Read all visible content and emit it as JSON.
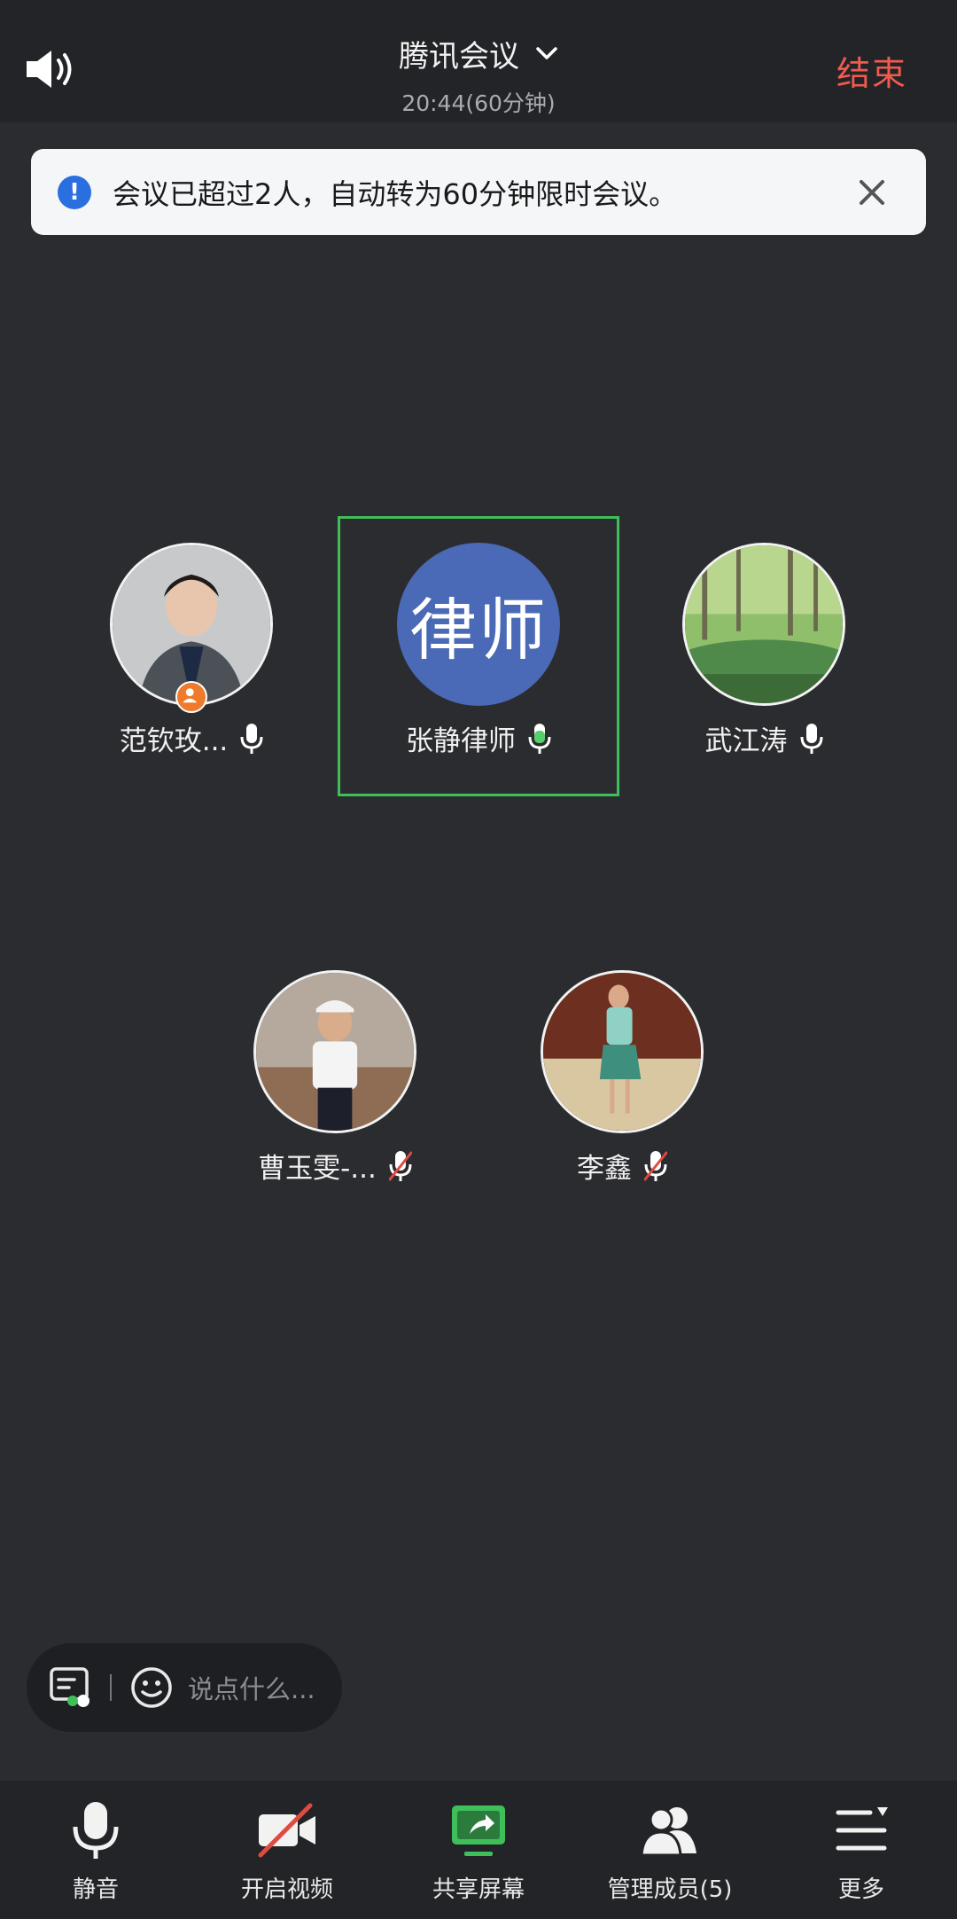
{
  "header": {
    "title": "腾讯会议",
    "subtitle": "20:44(60分钟)",
    "end_label": "结束"
  },
  "notice": {
    "message": "会议已超过2人，自动转为60分钟限时会议。"
  },
  "participants": [
    {
      "name": "范钦玫...",
      "mic": "on",
      "host": true
    },
    {
      "name": "张静律师",
      "avatar_text": "律师",
      "mic": "speaking",
      "active": true
    },
    {
      "name": "武江涛",
      "mic": "on"
    },
    {
      "name": "曹玉雯-...",
      "mic": "muted"
    },
    {
      "name": "李鑫",
      "mic": "muted"
    }
  ],
  "chat": {
    "placeholder": "说点什么..."
  },
  "toolbar": {
    "items": [
      {
        "label": "静音",
        "icon": "microphone-icon"
      },
      {
        "label": "开启视频",
        "icon": "camera-off-icon"
      },
      {
        "label": "共享屏幕",
        "icon": "share-screen-icon"
      },
      {
        "label": "管理成员(5)",
        "icon": "members-icon"
      },
      {
        "label": "更多",
        "icon": "more-menu-icon"
      }
    ]
  },
  "colors": {
    "background": "#2b2c2f",
    "end_button": "#f05a4f",
    "active_border": "#3fbf5a",
    "avatar_blue": "#4a69b6",
    "info_blue": "#2a6fe0"
  }
}
